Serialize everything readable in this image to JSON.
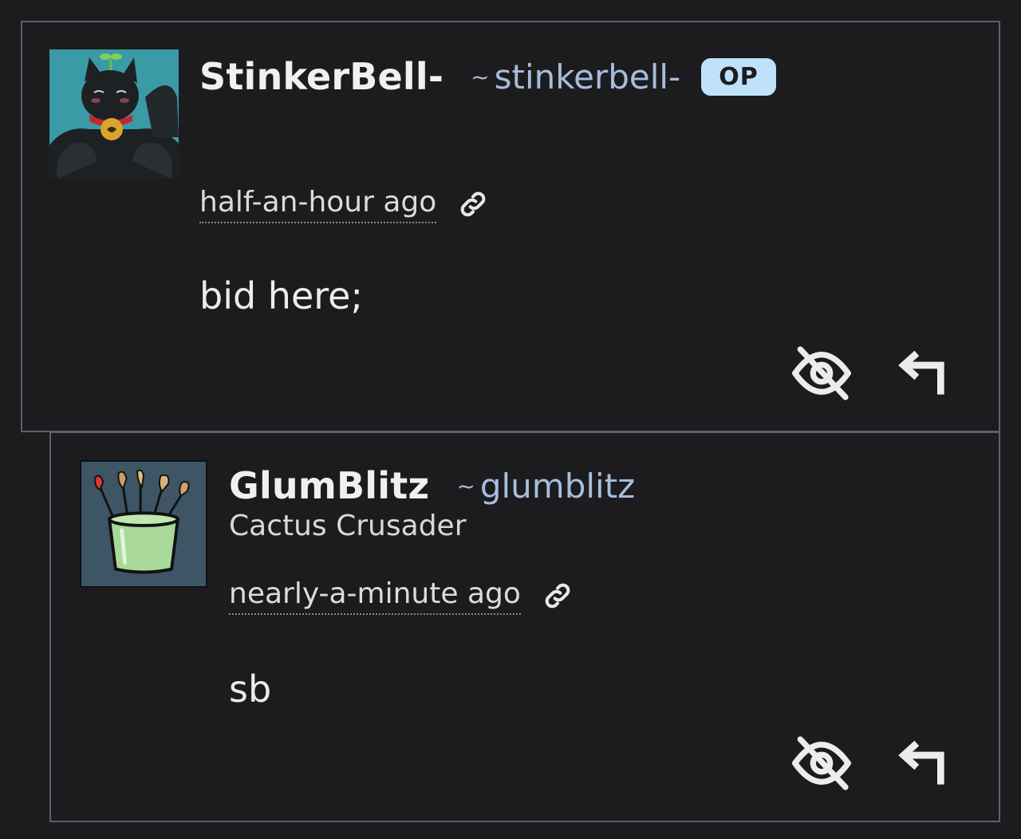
{
  "comments": [
    {
      "display_name": "StinkerBell-",
      "handle_prefix": "~",
      "handle": "stinkerbell-",
      "badge": "OP",
      "timestamp": "half-an-hour ago",
      "body": "bid here;",
      "avatar": "black-cat-avatar",
      "actions": [
        "hide-icon",
        "reply-icon"
      ]
    },
    {
      "display_name": "GlumBlitz",
      "handle_prefix": "~",
      "handle": "glumblitz",
      "user_title": "Cactus Crusader",
      "timestamp": "nearly-a-minute ago",
      "body": "sb",
      "avatar": "paintbrush-cup-avatar",
      "actions": [
        "hide-icon",
        "reply-icon"
      ]
    }
  ],
  "colors": {
    "background": "#1c1c1f",
    "border": "#5e5f6b",
    "handle": "#a6bddb",
    "op_badge": "#bfe1fa",
    "avatar1_bg": "#3a9aa6",
    "avatar2_bg": "#3e5566"
  }
}
